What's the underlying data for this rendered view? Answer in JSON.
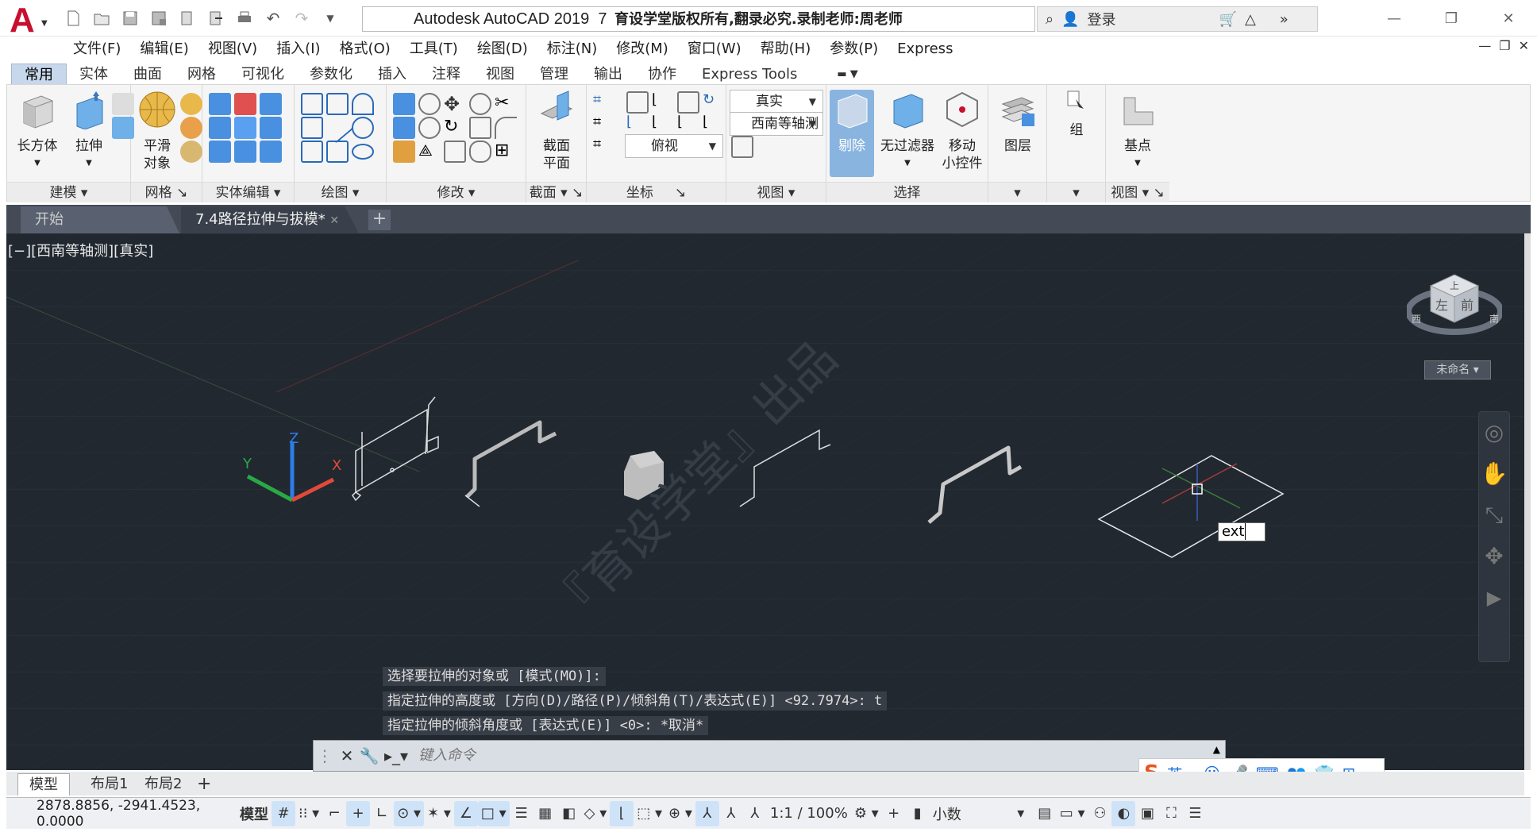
{
  "app": {
    "title": "Autodesk AutoCAD 2019",
    "file_prefix": "7",
    "watermark_title": "育设学堂版权所有,翻录必究.录制老师:周老师",
    "login": "登录"
  },
  "colors": {
    "accent": "#c8102e",
    "viewport_bg": "#212830",
    "ribbon_bg": "#f5f5f5"
  },
  "menu": [
    "文件(F)",
    "编辑(E)",
    "视图(V)",
    "插入(I)",
    "格式(O)",
    "工具(T)",
    "绘图(D)",
    "标注(N)",
    "修改(M)",
    "窗口(W)",
    "帮助(H)",
    "参数(P)",
    "Express"
  ],
  "ribbon_tabs": [
    "常用",
    "实体",
    "曲面",
    "网格",
    "可视化",
    "参数化",
    "插入",
    "注释",
    "视图",
    "管理",
    "输出",
    "协作",
    "Express Tools"
  ],
  "ribbon": {
    "box_label": "长方体",
    "extrude_label": "拉伸",
    "smooth_label": "平滑\n对象",
    "section_label": "截面\n平面",
    "visual_style": "真实",
    "view_name": "西南等轴测",
    "ucs_view": "俯视",
    "cull_label": "剔除",
    "nofilter_label": "无过滤器",
    "gizmo_label": "移动\n小控件",
    "layers_label": "图层",
    "group_label": "组",
    "base_label": "基点",
    "panels": [
      "建模",
      "网格",
      "实体编辑",
      "绘图",
      "修改",
      "截面",
      "坐标",
      "视图",
      "选择",
      "视图"
    ]
  },
  "file_tabs": [
    "开始",
    "7.4路径拉伸与拔模*"
  ],
  "viewport": {
    "label": "[−][西南等轴测][真实]",
    "watermark": "『育设学堂』出品",
    "dynamic_input": "ext",
    "viewcube_top": "上",
    "viewcube_left": "左",
    "viewcube_right": "前",
    "compass_w": "西",
    "compass_s": "南",
    "ucs_name": "未命名"
  },
  "command": {
    "history": [
      "选择要拉伸的对象或 [模式(MO)]:",
      "指定拉伸的高度或 [方向(D)/路径(P)/倾斜角(T)/表达式(E)] <92.7974>: t",
      "指定拉伸的倾斜角度或 [表达式(E)] <0>: *取消*"
    ],
    "placeholder": "键入命令"
  },
  "ime": {
    "lang": "英"
  },
  "layout_tabs": [
    "模型",
    "布局1",
    "布局2"
  ],
  "status": {
    "coords": "2878.8856, -2941.4523, 0.0000",
    "model": "模型",
    "scale": "1:1 / 100%",
    "units": "小数"
  }
}
